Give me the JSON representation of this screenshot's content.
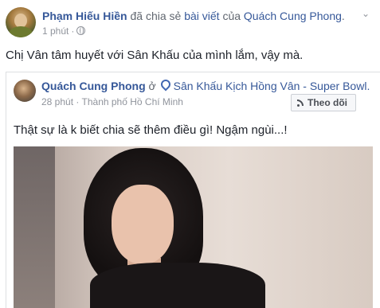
{
  "post": {
    "author": "Phạm Hiếu Hiền",
    "action": " đã chia sẻ ",
    "object_link": "bài viết",
    "of_text": " của ",
    "original_author": "Quách Cung Phong",
    "period": ".",
    "time": "1 phút",
    "separator": "·",
    "privacy_icon": "globe-icon",
    "body": "Chị Vân tâm huyết với Sân Khấu của mình lắm, vậy mà."
  },
  "shared": {
    "author": "Quách Cung Phong",
    "at_text": " ở ",
    "location_icon": "location-pin-icon",
    "location": "Sân Khấu Kịch Hồng Vân - Super Bowl.",
    "time": "28 phút",
    "separator": "·",
    "place": "Thành phố Hồ Chí Minh",
    "place_separator": "·",
    "follow_label": "Theo dõi",
    "body": "Thật sự là k biết chia sẽ thêm điều gì! Ngậm ngùi...!"
  },
  "colors": {
    "link": "#365899",
    "muted": "#90949c"
  }
}
